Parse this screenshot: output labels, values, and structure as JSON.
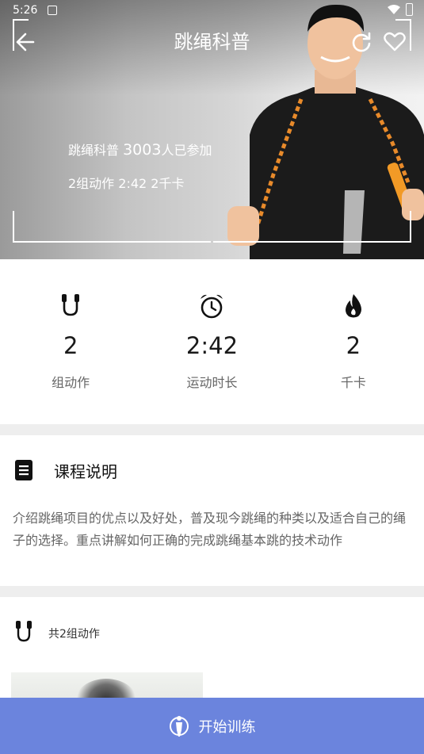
{
  "status_bar": {
    "time": "5:26"
  },
  "header": {
    "title": "跳绳科普",
    "participants_prefix": "跳绳科普 ",
    "participants_count": "3003",
    "participants_suffix": "人已参加",
    "summary": "2组动作 2:42 2千卡"
  },
  "stats": [
    {
      "icon": "jump-rope-icon",
      "value": "2",
      "label": "组动作"
    },
    {
      "icon": "alarm-clock-icon",
      "value": "2:42",
      "label": "运动时长"
    },
    {
      "icon": "flame-icon",
      "value": "2",
      "label": "千卡"
    }
  ],
  "course": {
    "icon": "document-icon",
    "title": "课程说明",
    "description": "介绍跳绳项目的优点以及好处，普及现今跳绳的种类以及适合自己的绳子的选择。重点讲解如何正确的完成跳绳基本跳的技术动作"
  },
  "actions": {
    "icon": "jump-rope-icon",
    "label": "共2组动作"
  },
  "start_button": {
    "icon": "person-icon",
    "label": "开始训练"
  },
  "colors": {
    "accent": "#6b84dd",
    "divider": "#eeeeee"
  }
}
